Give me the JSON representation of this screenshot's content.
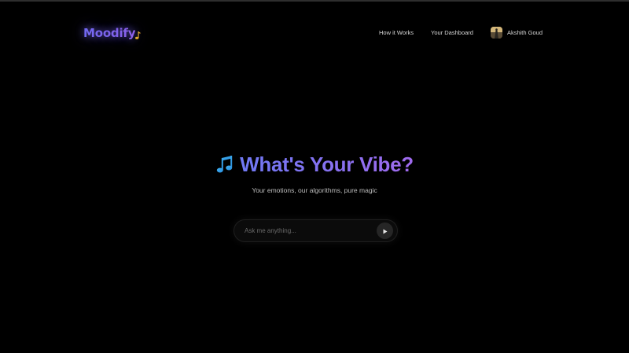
{
  "header": {
    "logo_text": "Moodify",
    "logo_icon": "music-note-icon",
    "nav": [
      {
        "label": "How it Works"
      },
      {
        "label": "Your Dashboard"
      }
    ],
    "user": {
      "name": "Akshith Goud",
      "avatar_icon": "avatar"
    }
  },
  "hero": {
    "title_icon": "musical-notes-icon",
    "title": "What's Your Vibe?",
    "subtitle": "Your emotions, our algorithms, pure magic"
  },
  "search": {
    "placeholder": "Ask me anything...",
    "value": "",
    "submit_icon": "play-icon"
  },
  "colors": {
    "background": "#000000",
    "accent_start": "#6f78f3",
    "accent_end": "#a06aee",
    "text_muted": "#bdbdbd"
  }
}
